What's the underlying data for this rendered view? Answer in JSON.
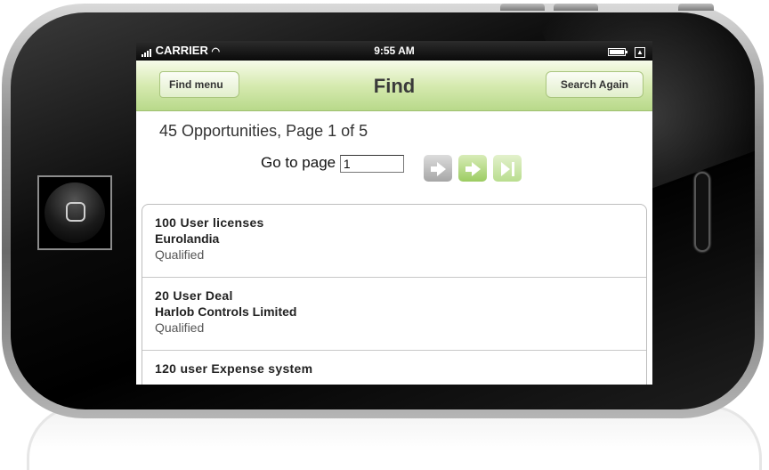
{
  "status_bar": {
    "carrier": "CARRIER",
    "time": "9:55 AM"
  },
  "nav": {
    "title": "Find",
    "back_label": "Find menu",
    "search_label": "Search Again"
  },
  "summary": "45 Opportunities, Page 1 of 5",
  "pager": {
    "label": "Go to page",
    "value": "1"
  },
  "opportunities": [
    {
      "name": "100 User licenses",
      "account": "Eurolandia",
      "status": "Qualified"
    },
    {
      "name": "20 User Deal",
      "account": "Harlob Controls Limited",
      "status": "Qualified"
    },
    {
      "name": "120 user Expense system",
      "account": "",
      "status": ""
    }
  ],
  "colors": {
    "nav_green": "#c9e39c",
    "button_green": "#9ccc62"
  }
}
